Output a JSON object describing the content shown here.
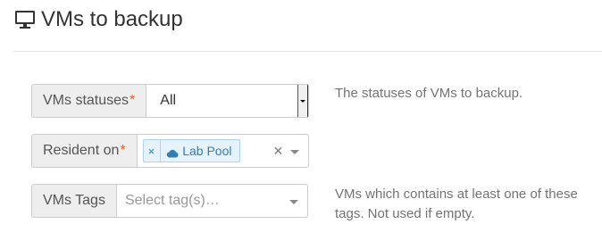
{
  "header": {
    "icon": "monitor-icon",
    "title": "VMs to backup"
  },
  "fields": {
    "statuses": {
      "label": "VMs statuses",
      "required_mark": "*",
      "value": "All",
      "help": "The statuses of VMs to backup."
    },
    "resident_on": {
      "label": "Resident on",
      "required_mark": "*",
      "tag_remove": "×",
      "tag_icon": "cloud-icon",
      "tag_label": "Lab Pool",
      "clear": "×"
    },
    "tags": {
      "label": "VMs Tags",
      "placeholder": "Select tag(s)…",
      "help_line1": "VMs which contains at least one of these",
      "help_line2": "tags. Not used if empty."
    }
  },
  "colors": {
    "required": "#e4652e",
    "tag_text": "#2e7fb6",
    "tag_bg": "#e6f3fc"
  }
}
